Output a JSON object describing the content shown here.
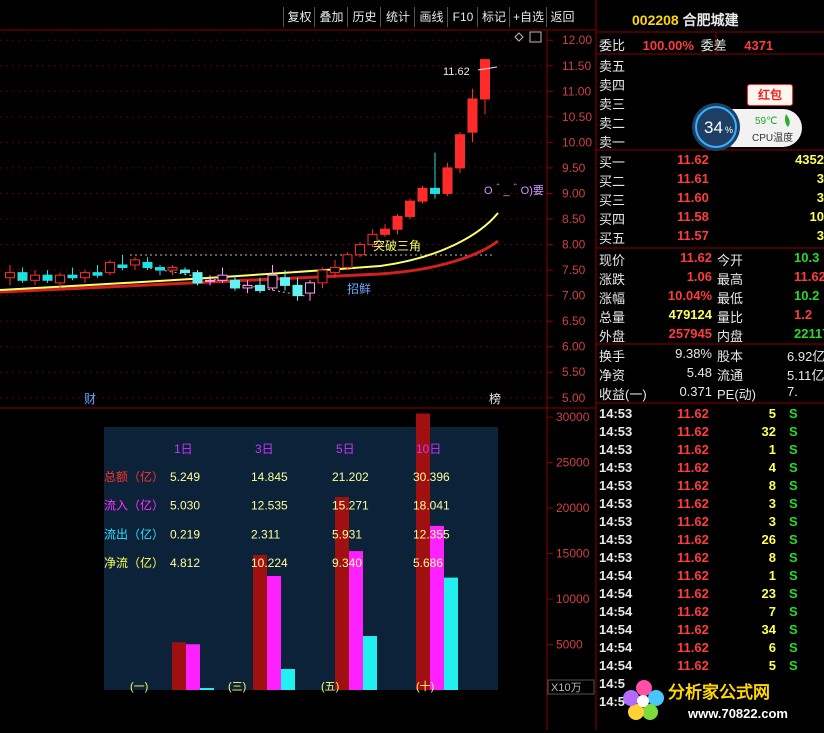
{
  "toolbar": {
    "buttons": [
      "复权",
      "叠加",
      "历史",
      "统计",
      "画线",
      "F10",
      "标记",
      "+自选",
      "返回"
    ]
  },
  "stock": {
    "code": "002208",
    "name": "合肥城建"
  },
  "orderbook": {
    "weibi_label": "委比",
    "weibi_value": "100.00%",
    "weicha_label": "委差",
    "weicha_value": "4371",
    "sell": [
      {
        "label": "卖五"
      },
      {
        "label": "卖四"
      },
      {
        "label": "卖三"
      },
      {
        "label": "卖二"
      },
      {
        "label": "卖一"
      }
    ],
    "buy": [
      {
        "label": "买一",
        "price": "11.62",
        "vol": "4352"
      },
      {
        "label": "买二",
        "price": "11.61",
        "vol": "3"
      },
      {
        "label": "买三",
        "price": "11.60",
        "vol": "3"
      },
      {
        "label": "买四",
        "price": "11.58",
        "vol": "10"
      },
      {
        "label": "买五",
        "price": "11.57",
        "vol": "3"
      }
    ]
  },
  "quote": {
    "rows": [
      {
        "l1": "现价",
        "v1": "11.62",
        "l2": "今开",
        "v2": "10.3",
        "c1": "red",
        "c2": "grn"
      },
      {
        "l1": "涨跌",
        "v1": "1.06",
        "l2": "最高",
        "v2": "11.62",
        "c1": "red",
        "c2": "red"
      },
      {
        "l1": "涨幅",
        "v1": "10.04%",
        "l2": "最低",
        "v2": "10.2",
        "c1": "red",
        "c2": "grn"
      },
      {
        "l1": "总量",
        "v1": "479124",
        "l2": "量比",
        "v2": "1.2",
        "c1": "yel",
        "c2": "red"
      },
      {
        "l1": "外盘",
        "v1": "257945",
        "l2": "内盘",
        "v2": "22117",
        "c1": "red",
        "c2": "grn"
      }
    ],
    "rows2": [
      {
        "l1": "换手",
        "v1": "9.38%",
        "l2": "股本",
        "v2": "6.92亿"
      },
      {
        "l1": "净资",
        "v1": "5.48",
        "l2": "流通",
        "v2": "5.11亿"
      },
      {
        "l1": "收益(一)",
        "v1": "0.371",
        "l2": "PE(动)",
        "v2": "7."
      }
    ]
  },
  "ticks": [
    {
      "time": "14:53",
      "price": "11.62",
      "vol": "5",
      "side": "S"
    },
    {
      "time": "14:53",
      "price": "11.62",
      "vol": "32",
      "side": "S"
    },
    {
      "time": "14:53",
      "price": "11.62",
      "vol": "1",
      "side": "S"
    },
    {
      "time": "14:53",
      "price": "11.62",
      "vol": "4",
      "side": "S"
    },
    {
      "time": "14:53",
      "price": "11.62",
      "vol": "8",
      "side": "S"
    },
    {
      "time": "14:53",
      "price": "11.62",
      "vol": "3",
      "side": "S"
    },
    {
      "time": "14:53",
      "price": "11.62",
      "vol": "3",
      "side": "S"
    },
    {
      "time": "14:53",
      "price": "11.62",
      "vol": "26",
      "side": "S"
    },
    {
      "time": "14:53",
      "price": "11.62",
      "vol": "8",
      "side": "S"
    },
    {
      "time": "14:54",
      "price": "11.62",
      "vol": "1",
      "side": "S"
    },
    {
      "time": "14:54",
      "price": "11.62",
      "vol": "23",
      "side": "S"
    },
    {
      "time": "14:54",
      "price": "11.62",
      "vol": "7",
      "side": "S"
    },
    {
      "time": "14:54",
      "price": "11.62",
      "vol": "34",
      "side": "S"
    },
    {
      "time": "14:54",
      "price": "11.62",
      "vol": "6",
      "side": "S"
    },
    {
      "time": "14:54",
      "price": "11.62",
      "vol": "5",
      "side": "S"
    },
    {
      "time": "14:5",
      "price": "",
      "vol": "",
      "side": ""
    },
    {
      "time": "14:5",
      "price": "",
      "vol": "",
      "side": ""
    }
  ],
  "cpu": {
    "percent": "34",
    "percent_unit": "%",
    "temp": "59℃",
    "label": "CPU温度",
    "hongbao": "红包"
  },
  "logo": {
    "text": "分析家公式网",
    "url": "www.70822.com"
  },
  "chart_data": [
    {
      "type": "candlestick",
      "ylim": [
        4.8,
        12.2
      ],
      "yticks": [
        "12.00",
        "11.50",
        "11.00",
        "10.50",
        "10.00",
        "9.50",
        "9.00",
        "8.50",
        "8.00",
        "7.50",
        "7.00",
        "6.50",
        "6.00",
        "5.50",
        "5.00"
      ],
      "candles": [
        [
          7.35,
          7.6,
          7.2,
          7.45
        ],
        [
          7.45,
          7.55,
          7.25,
          7.3
        ],
        [
          7.3,
          7.5,
          7.2,
          7.4
        ],
        [
          7.4,
          7.5,
          7.25,
          7.3
        ],
        [
          7.25,
          7.45,
          7.15,
          7.4
        ],
        [
          7.4,
          7.55,
          7.3,
          7.35
        ],
        [
          7.35,
          7.5,
          7.25,
          7.45
        ],
        [
          7.45,
          7.6,
          7.35,
          7.4
        ],
        [
          7.45,
          7.7,
          7.4,
          7.65
        ],
        [
          7.6,
          7.8,
          7.5,
          7.55
        ],
        [
          7.6,
          7.75,
          7.5,
          7.7
        ],
        [
          7.65,
          7.75,
          7.5,
          7.55
        ],
        [
          7.55,
          7.6,
          7.4,
          7.5
        ],
        [
          7.5,
          7.6,
          7.4,
          7.55
        ],
        [
          7.5,
          7.55,
          7.4,
          7.45
        ],
        [
          7.45,
          7.5,
          7.2,
          7.25
        ],
        [
          7.3,
          7.4,
          7.2,
          7.3
        ],
        [
          7.3,
          7.55,
          7.25,
          7.4
        ],
        [
          7.3,
          7.4,
          7.1,
          7.15
        ],
        [
          7.15,
          7.3,
          7.05,
          7.2
        ],
        [
          7.2,
          7.35,
          7.05,
          7.1
        ],
        [
          7.15,
          7.6,
          7.1,
          7.4
        ],
        [
          7.35,
          7.5,
          7.1,
          7.2
        ],
        [
          7.2,
          7.35,
          6.9,
          7.0
        ],
        [
          7.05,
          7.3,
          6.9,
          7.25
        ],
        [
          7.25,
          7.55,
          7.15,
          7.5
        ],
        [
          7.45,
          7.7,
          7.35,
          7.55
        ],
        [
          7.55,
          7.85,
          7.5,
          7.8
        ],
        [
          7.8,
          8.05,
          7.75,
          8.0
        ],
        [
          8.0,
          8.3,
          7.95,
          8.2
        ],
        [
          8.2,
          8.4,
          8.15,
          8.3
        ],
        [
          8.3,
          8.6,
          8.2,
          8.55
        ],
        [
          8.55,
          8.9,
          8.5,
          8.85
        ],
        [
          8.85,
          9.15,
          8.8,
          9.1
        ],
        [
          9.1,
          9.8,
          8.9,
          9.0
        ],
        [
          9.0,
          9.6,
          8.95,
          9.5
        ],
        [
          9.5,
          10.2,
          9.4,
          10.15
        ],
        [
          10.2,
          11.05,
          10.0,
          10.85
        ],
        [
          10.85,
          11.62,
          10.55,
          11.62
        ]
      ],
      "annotations": [
        "11.62",
        "突破三角",
        "招鲜",
        "O＾_＾O)要",
        "财",
        "榜"
      ]
    },
    {
      "type": "bar",
      "categories": [
        "1日",
        "3日",
        "5日",
        "10日"
      ],
      "ylim": [
        0,
        31000
      ],
      "yticks": [
        "30000",
        "25000",
        "20000",
        "15000",
        "10000",
        "5000"
      ],
      "yunit": "X10万",
      "series": [
        {
          "values": [
            5249,
            14845,
            21202,
            30396
          ]
        },
        {
          "values": [
            5030,
            12535,
            15271,
            18041
          ]
        },
        {
          "values": [
            219,
            2311,
            5931,
            12355
          ]
        }
      ],
      "table": {
        "rows": [
          {
            "label": "总额（亿）",
            "values": [
              "5.249",
              "14.845",
              "21.202",
              "30.396"
            ]
          },
          {
            "label": "流入（亿）",
            "values": [
              "5.030",
              "12.535",
              "15.271",
              "18.041"
            ]
          },
          {
            "label": "流出（亿）",
            "values": [
              "0.219",
              "2.311",
              "5.931",
              "12.355"
            ]
          },
          {
            "label": "净流（亿）",
            "values": [
              "4.812",
              "10.224",
              "9.340",
              "5.686"
            ]
          }
        ]
      },
      "group_labels": [
        "(一)",
        "(三)",
        "(五)",
        "(十)"
      ]
    }
  ]
}
